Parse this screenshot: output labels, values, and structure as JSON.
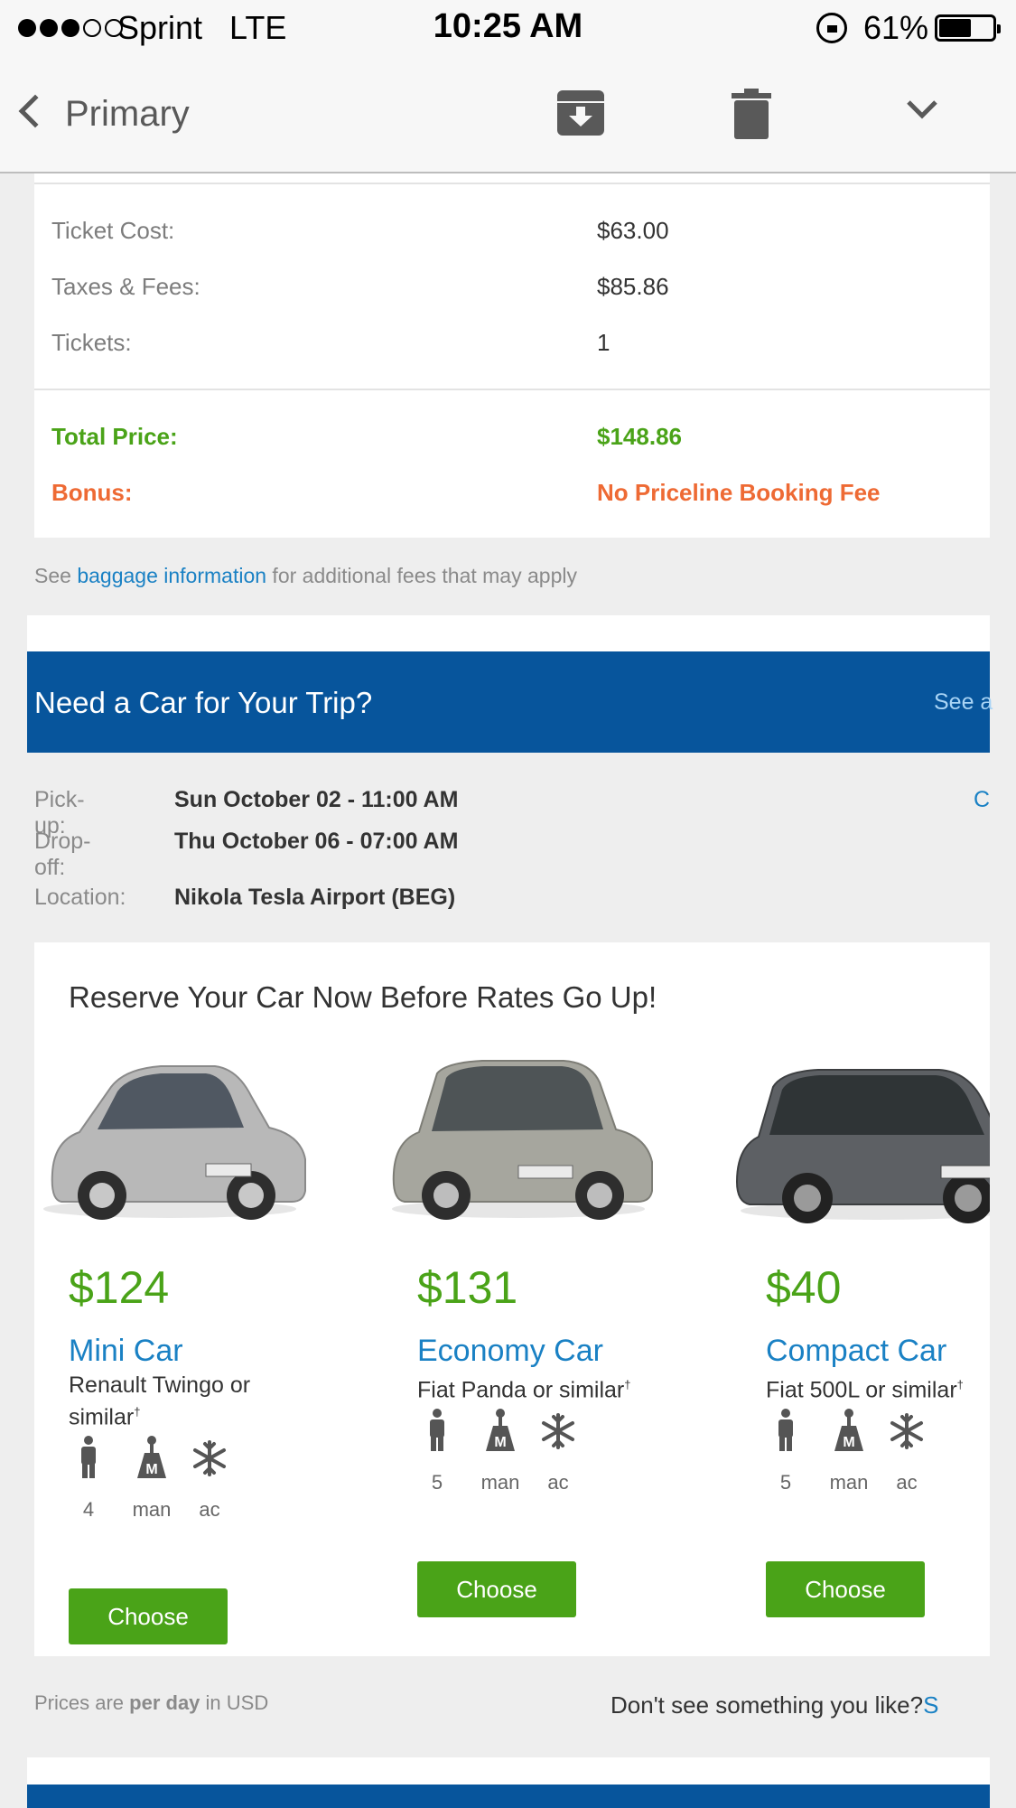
{
  "status_bar": {
    "signal_dots_filled": 3,
    "signal_dots_empty": 2,
    "carrier": "Sprint",
    "network": "LTE",
    "time": "10:25 AM",
    "battery_percent_label": "61%",
    "battery_level": 0.61
  },
  "nav": {
    "back_label": "Primary",
    "icons": [
      "archive-icon",
      "trash-icon",
      "chevron-down-icon"
    ]
  },
  "pricing": {
    "ticket_cost_label": "Ticket Cost:",
    "ticket_cost_value": "$63.00",
    "taxes_label": "Taxes & Fees:",
    "taxes_value": "$85.86",
    "tickets_label": "Tickets:",
    "tickets_value": "1",
    "total_label": "Total Price:",
    "total_value": "$148.86",
    "bonus_label": "Bonus:",
    "bonus_value": "No Priceline Booking Fee"
  },
  "baggage": {
    "prefix": "See ",
    "link": "baggage information",
    "suffix": " for additional fees that may apply"
  },
  "car_section": {
    "title": "Need a Car for Your Trip?",
    "see_all": "See a",
    "pickup_label": "Pick-up:",
    "pickup_value": "Sun October 02 - 11:00 AM",
    "dropoff_label": "Drop-off:",
    "dropoff_value": "Thu October 06 - 07:00 AM",
    "location_label": "Location:",
    "location_value": "Nikola Tesla Airport (BEG)",
    "change_link": "C",
    "offers_title": "Reserve Your Car Now Before Rates Go Up!",
    "cars": [
      {
        "price": "$124",
        "class": "Mini Car",
        "model": "Renault Twingo or similar",
        "mark": "†",
        "passengers": "4",
        "transmission": "man",
        "ac": "ac",
        "button": "Choose",
        "color": "#b8b8b8"
      },
      {
        "price": "$131",
        "class": "Economy Car",
        "model": "Fiat Panda or similar",
        "mark": "†",
        "passengers": "5",
        "transmission": "man",
        "ac": "ac",
        "button": "Choose",
        "color": "#a6a69e"
      },
      {
        "price": "$40",
        "class": "Compact Car",
        "model": "Fiat 500L or similar",
        "mark": "†",
        "passengers": "5",
        "transmission": "man",
        "ac": "ac",
        "button": "Choose",
        "color": "#5d6064"
      }
    ],
    "footer_prefix": "Prices are ",
    "footer_bold": "per day",
    "footer_suffix": " in USD",
    "dont_see": "Don't see something you like?",
    "dont_see_link": "S"
  },
  "colors": {
    "brand_blue": "#07559c",
    "green": "#4aa318",
    "orange": "#ee6a34",
    "link": "#1a81c4"
  }
}
